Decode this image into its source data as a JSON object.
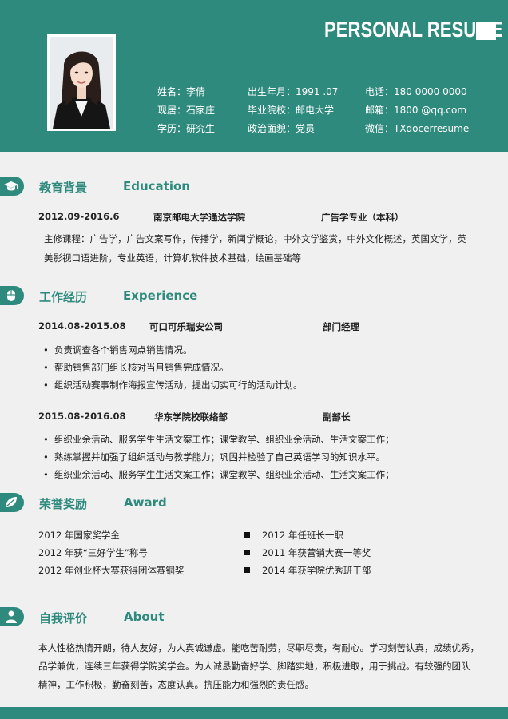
{
  "header": {
    "title": "PERSONAL RESUME",
    "info": {
      "name": "姓名：李倩",
      "residence": "现居：石家庄",
      "degree": "学历：研究生",
      "birth": "出生年月：1991 .07",
      "school": "毕业院校：邮电大学",
      "politics": "政治面貌：党员",
      "phone": "电话：180 0000 0000",
      "email": "邮箱：1800 @qq.com",
      "wechat": "微信：TXdocerresume"
    }
  },
  "education": {
    "title_cn": "教育背景",
    "title_en": "Education",
    "date": "2012.09-2016.6",
    "school": "南京邮电大学通达学院",
    "major": "广告学专业（本科）",
    "courses_line1": "主修课程：广告学，广告文案写作，传播学，新闻学概论，中外文学鉴赏，中外文化概述，英国文学，英",
    "courses_line2": "美影视口语进阶，专业英语，计算机软件技术基础，绘画基础等"
  },
  "experience": {
    "title_cn": "工作经历",
    "title_en": "Experience",
    "jobs": [
      {
        "date": "2014.08-2015.08",
        "company": "可口可乐瑞安公司",
        "role": "部门经理",
        "items": [
          "负责调查各个销售网点销售情况。",
          "帮助销售部门组长核对当月销售完成情况。",
          "组织活动赛事制作海报宣传活动，提出切实可行的活动计划。"
        ]
      },
      {
        "date": "2015.08-2016.08",
        "company": "华东学院校联络部",
        "role": "副部长",
        "items": [
          "组织业余活动、服务学生生活文案工作；课堂教学、组织业余活动、生活文案工作；",
          "熟练掌握并加强了组织活动与教学能力；巩固并检验了自己英语学习的知识水平。",
          "组织业余活动、服务学生生活文案工作；课堂教学、组织业余活动、生活文案工作；"
        ]
      }
    ]
  },
  "award": {
    "title_cn": "荣誉奖励",
    "title_en": "Award",
    "left": [
      "2012 年国家奖学金",
      "2012 年获“三好学生”称号",
      "2012 年创业杯大赛获得团体赛铜奖"
    ],
    "right": [
      "2012 年任班长一职",
      "2011 年获营销大赛一等奖",
      "2014 年获学院优秀班干部"
    ]
  },
  "about": {
    "title_cn": "自我评价",
    "title_en": "About",
    "lines": [
      "本人性格热情开朗，待人友好，为人真诚谦虚。能吃苦耐劳，尽职尽责，有耐心。学习刻苦认真，成绩优秀，",
      "品学兼优，连续三年获得学院奖学金。为人诚恳勤奋好学、脚踏实地，积极进取，用于挑战。有较强的团队",
      "精神，工作积极，勤奋刻苦，态度认真。抗压能力和强烈的责任感。"
    ]
  },
  "icons": {
    "education": "graduation-cap-icon",
    "experience": "mouse-icon",
    "award": "leaf-icon",
    "about": "person-icon"
  },
  "colors": {
    "accent": "#2f8a7e",
    "background": "#f0f0f0"
  }
}
